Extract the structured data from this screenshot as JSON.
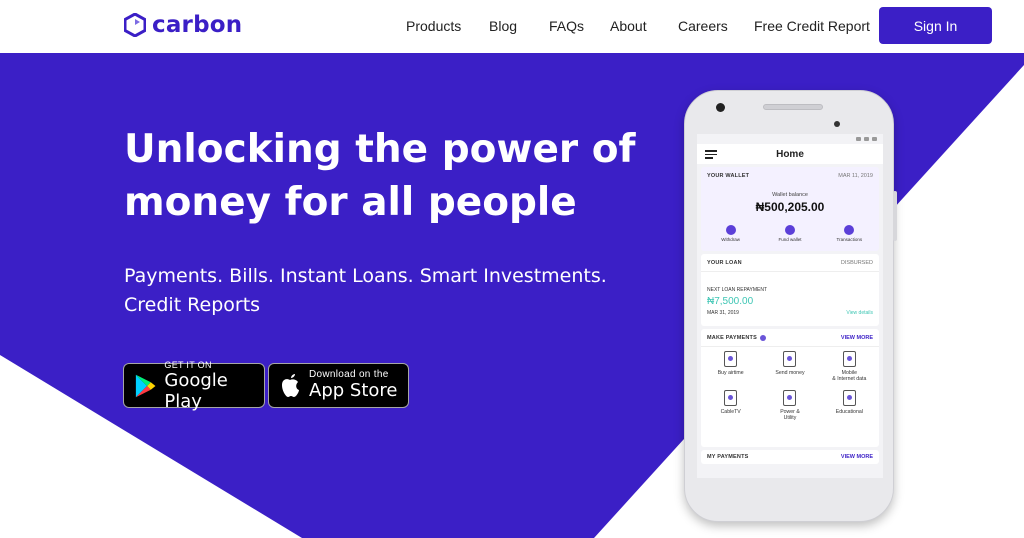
{
  "brand": {
    "name": "carbon",
    "color": "#3b1fc6"
  },
  "nav": {
    "links": [
      "Products",
      "Blog",
      "FAQs",
      "About",
      "Careers",
      "Free Credit Report"
    ],
    "signin": "Sign In"
  },
  "hero": {
    "headline": [
      "Unlocking the power of",
      "money for all people"
    ],
    "subline": [
      "Payments. Bills. Instant Loans. Smart Investments.",
      "Credit Reports"
    ],
    "bg_color": "#3b1fc6"
  },
  "badges": {
    "google": {
      "small": "GET IT ON",
      "big": "Google Play"
    },
    "apple": {
      "small": "Download on the",
      "big": "App Store"
    }
  },
  "phone": {
    "title": "Home",
    "wallet": {
      "label": "YOUR WALLET",
      "date": "MAR 11, 2019",
      "balance_label": "Wallet balance",
      "balance": "₦500,205.00",
      "actions": [
        "Withdraw",
        "Fund wallet",
        "Transactions"
      ]
    },
    "loan": {
      "label": "YOUR LOAN",
      "status": "DISBURSED",
      "next_label": "NEXT LOAN REPAYMENT",
      "amount": "₦7,500.00",
      "date": "MAR 31, 2019",
      "details": "View details"
    },
    "payments": {
      "label": "MAKE PAYMENTS",
      "more": "VIEW MORE",
      "items": [
        [
          "Buy airtime"
        ],
        [
          "Send money"
        ],
        [
          "Mobile",
          "& Internet data"
        ],
        [
          "CableTV"
        ],
        [
          "Power &",
          "Utility"
        ],
        [
          "Educational"
        ]
      ]
    },
    "my_payments": {
      "label": "MY PAYMENTS",
      "more": "VIEW MORE"
    }
  }
}
